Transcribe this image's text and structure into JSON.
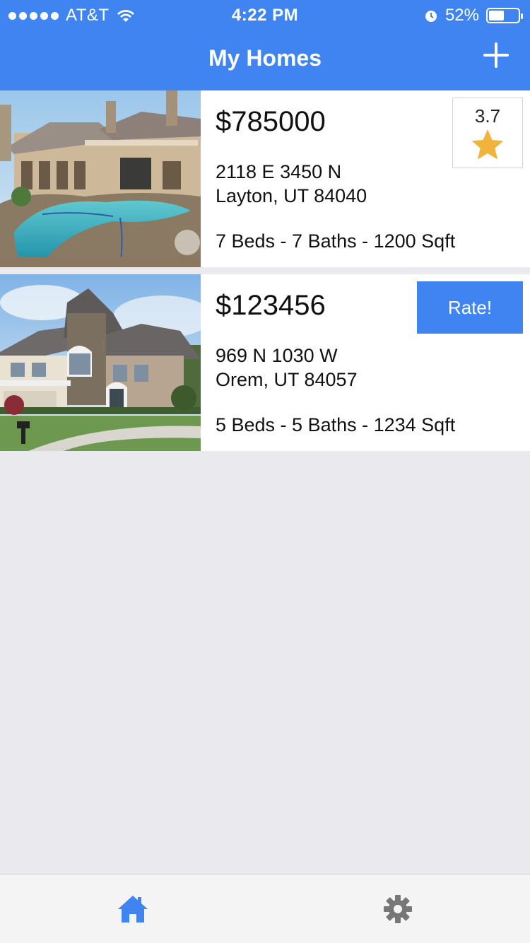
{
  "status_bar": {
    "carrier": "AT&T",
    "time": "4:22 PM",
    "battery": "52%",
    "battery_level": 0.52
  },
  "header": {
    "title": "My Homes",
    "add_icon": "plus-icon"
  },
  "homes": [
    {
      "price": "$785000",
      "street": "2118 E 3450 N",
      "city": "Layton, UT 84040",
      "specs": "7 Beds - 7 Baths - 1200 Sqft",
      "rating": "3.7",
      "rating_icon": "star-icon",
      "photo": "luxury-house-with-pool"
    },
    {
      "price": "$123456",
      "street": "969 N 1030 W",
      "city": "Orem, UT 84057",
      "specs": "5 Beds - 5 Baths - 1234 Sqft",
      "rate_label": "Rate!",
      "photo": "two-story-stone-house"
    }
  ],
  "tabbar": {
    "home_icon": "home-icon",
    "settings_icon": "gear-icon"
  },
  "colors": {
    "accent": "#3f84f0",
    "star": "#f0b43c",
    "background": "#e9e9ee"
  }
}
